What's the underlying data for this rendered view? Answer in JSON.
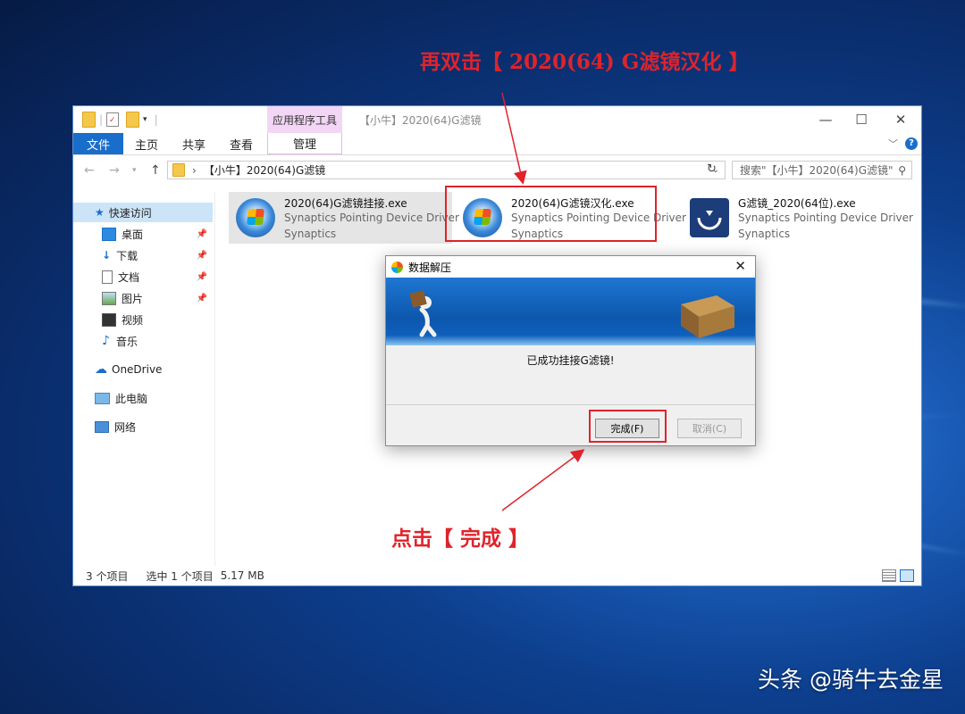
{
  "annotations": {
    "top": "再双击【 2020(64) G滤镜汉化 】",
    "bottom": "点击【 完成 】"
  },
  "watermark": "头条 @骑牛去金星",
  "explorer": {
    "app_tools_tab": "应用程序工具",
    "window_title": "【小牛】2020(64)G滤镜",
    "window_controls": {
      "minimize": "—",
      "maximize": "☐",
      "close": "✕"
    },
    "ribbon_tabs": {
      "file": "文件",
      "home": "主页",
      "share": "共享",
      "view": "查看",
      "manage": "管理"
    },
    "address": {
      "path": "【小牛】2020(64)G滤镜",
      "search_placeholder": "搜索\"【小牛】2020(64)G滤镜\""
    },
    "sidebar": {
      "quick_access": "快速访问",
      "items": [
        "桌面",
        "下载",
        "文档",
        "图片",
        "视频",
        "音乐"
      ],
      "onedrive": "OneDrive",
      "this_pc": "此电脑",
      "network": "网络"
    },
    "files": [
      {
        "name": "2020(64)G滤镜挂接.exe",
        "desc": "Synaptics Pointing Device Driver",
        "company": "Synaptics"
      },
      {
        "name": "2020(64)G滤镜汉化.exe",
        "desc": "Synaptics Pointing Device Driver",
        "company": "Synaptics"
      },
      {
        "name": "G滤镜_2020(64位).exe",
        "desc": "Synaptics Pointing Device Driver",
        "company": "Synaptics"
      }
    ],
    "status": {
      "count": "3 个项目",
      "selected": "选中 1 个项目",
      "size": "5.17 MB"
    }
  },
  "dialog": {
    "title": "数据解压",
    "message": "已成功挂接G滤镜!",
    "ok_button": "完成(F)",
    "cancel_button": "取消(C)"
  }
}
